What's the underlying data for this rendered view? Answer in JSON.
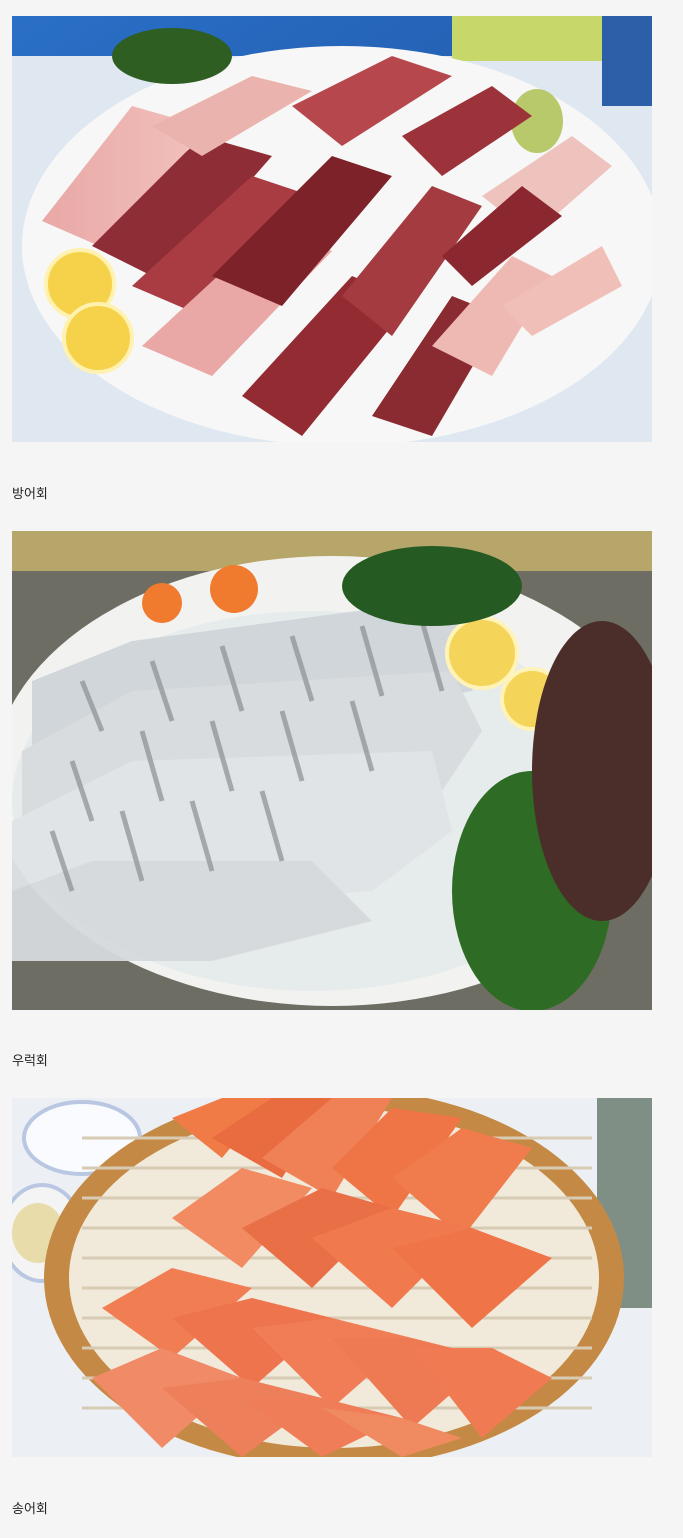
{
  "items": [
    {
      "caption": "방어회"
    },
    {
      "caption": "우럭회"
    },
    {
      "caption": "송어회"
    }
  ],
  "colors": {
    "background": "#f5f5f5",
    "yellowtail_dark": "#8d2b34",
    "yellowtail_light": "#e7a6a0",
    "rockfish_flesh": "#e8ecee",
    "salmon_trout": "#f06d3e"
  }
}
